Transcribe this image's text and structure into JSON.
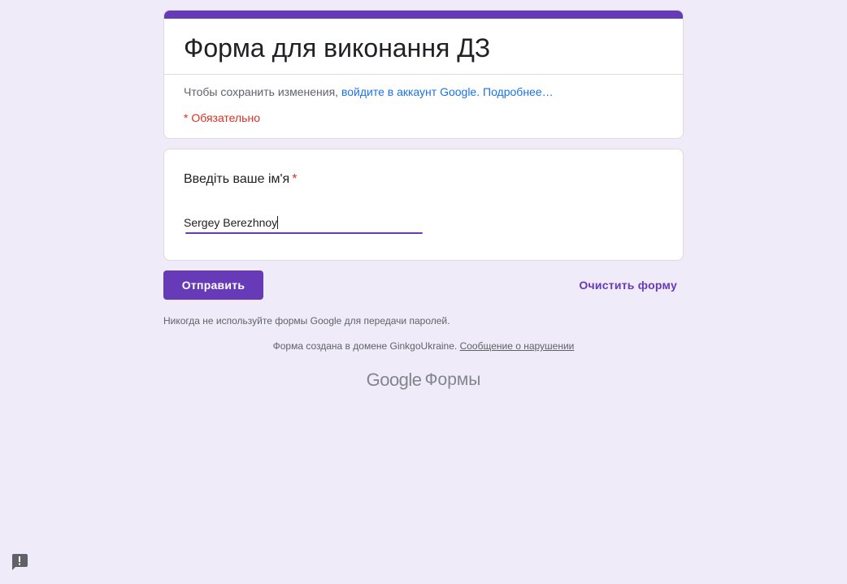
{
  "header": {
    "title": "Форма для виконання ДЗ",
    "signin_prefix": "Чтобы сохранить изменения,",
    "signin_link": "войдите в аккаунт Google.",
    "learn_more": "Подробнее…",
    "required_note": "* Обязательно"
  },
  "question": {
    "title": "Введіть ваше ім'я",
    "required_marker": "*",
    "answer_value": "Sergey Berezhnoy"
  },
  "actions": {
    "submit_label": "Отправить",
    "clear_label": "Очистить форму"
  },
  "footer": {
    "password_note": "Никогда не используйте формы Google для передачи паролей.",
    "domain_note": "Форма создана в домене GinkgoUkraine.",
    "report_link": "Сообщение о нарушении",
    "brand_logo": "Google",
    "brand_product": "Формы"
  },
  "colors": {
    "accent": "#673ab7",
    "background": "#f0ebf8",
    "link": "#1a73e8",
    "required": "#d93025"
  },
  "icons": {
    "report_problem": "report-problem-icon"
  }
}
